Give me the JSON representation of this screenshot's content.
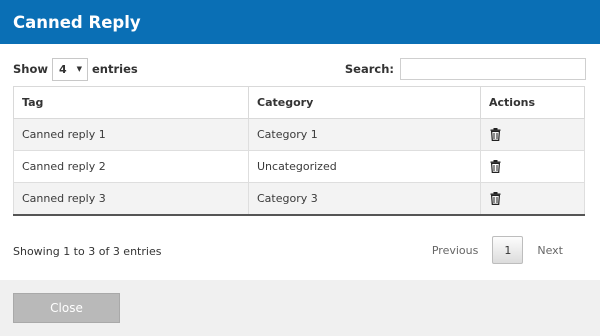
{
  "dialog": {
    "title": "Canned Reply"
  },
  "length": {
    "show_label": "Show",
    "selected": "4",
    "entries_label": "entries"
  },
  "search": {
    "label": "Search:",
    "placeholder": "",
    "value": ""
  },
  "table": {
    "columns": [
      "Tag",
      "Category",
      "Actions"
    ],
    "rows": [
      {
        "tag": "Canned reply 1",
        "category": "Category 1",
        "action_icon": "trash-icon"
      },
      {
        "tag": "Canned reply 2",
        "category": "Uncategorized",
        "action_icon": "trash-icon"
      },
      {
        "tag": "Canned reply 3",
        "category": "Category 3",
        "action_icon": "trash-icon"
      }
    ]
  },
  "info": {
    "text": "Showing 1 to 3 of 3 entries"
  },
  "pagination": {
    "previous": "Previous",
    "current": "1",
    "next": "Next"
  },
  "footer": {
    "close_label": "Close"
  }
}
